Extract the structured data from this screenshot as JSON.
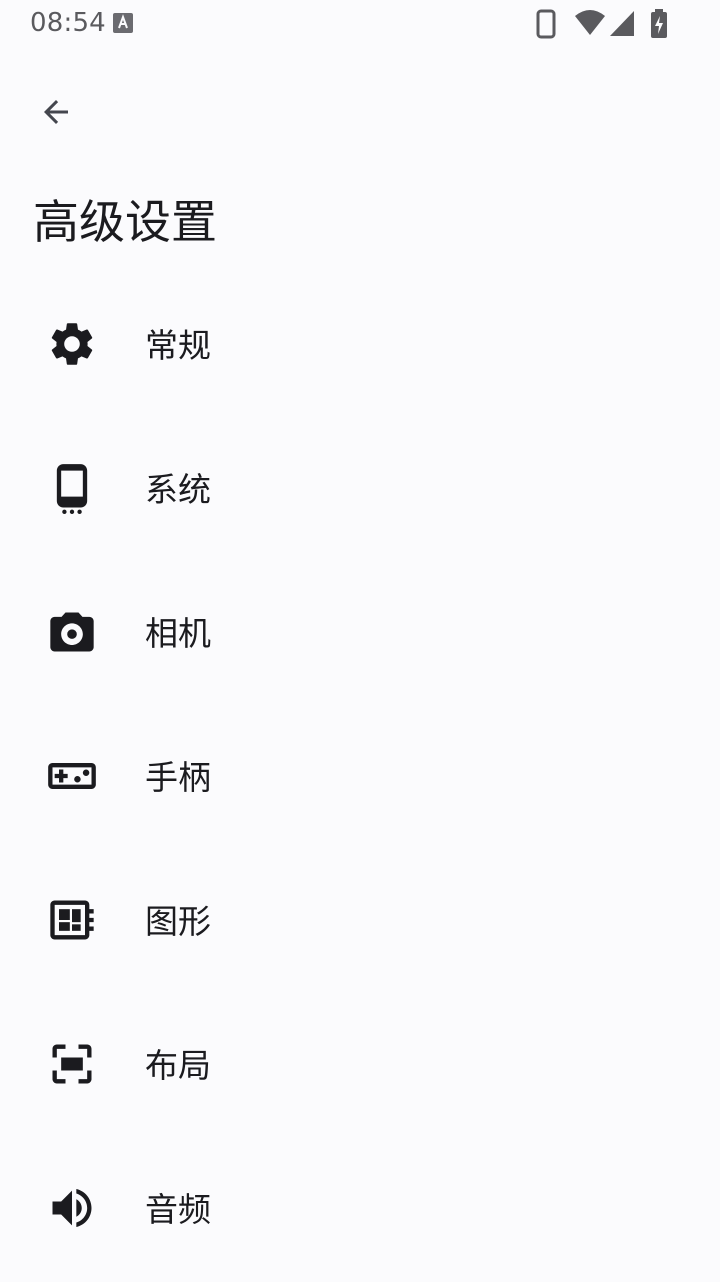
{
  "status_bar": {
    "time": "08:54"
  },
  "header": {
    "title": "高级设置"
  },
  "menu": {
    "items": [
      {
        "label": "常规",
        "icon": "gear-icon"
      },
      {
        "label": "系统",
        "icon": "phone-icon"
      },
      {
        "label": "相机",
        "icon": "camera-icon"
      },
      {
        "label": "手柄",
        "icon": "gamepad-icon"
      },
      {
        "label": "图形",
        "icon": "graphics-icon"
      },
      {
        "label": "布局",
        "icon": "fullscreen-icon"
      },
      {
        "label": "音频",
        "icon": "volume-icon"
      }
    ]
  },
  "colors": {
    "background": "#FBFBFD",
    "text": "#1B1B1F",
    "status_text": "#5A5A5E"
  }
}
